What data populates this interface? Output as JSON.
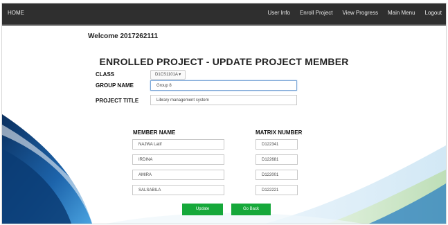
{
  "nav": {
    "home": "HOME",
    "links": [
      "User Info",
      "Enroll Project",
      "View Progress",
      "Main Menu",
      "Logout"
    ]
  },
  "welcome": "Welcome 2017262111",
  "page_title": "ENROLLED PROJECT - UPDATE PROJECT MEMBER",
  "form": {
    "class_label": "CLASS",
    "class_value": "D1CS1101A ▾",
    "group_label": "GROUP NAME",
    "group_value": "Group 8",
    "title_label": "PROJECT TITLE",
    "title_value": "Library management system"
  },
  "members": {
    "name_header": "MEMBER NAME",
    "matrix_header": "MATRIX NUMBER",
    "rows": [
      {
        "name": "NAJWA Latif",
        "matrix": "D122341"
      },
      {
        "name": "IRDINA",
        "matrix": "D122681"
      },
      {
        "name": "AMIRA",
        "matrix": "D122001"
      },
      {
        "name": "SALSABILA",
        "matrix": "D122221"
      }
    ]
  },
  "buttons": {
    "update": "Update",
    "back": "Go Back"
  },
  "colors": {
    "nav": "#2f2f2f",
    "button": "#16a83a",
    "wave_dark": "#0c3a6e",
    "wave_light": "#3b8fd0"
  }
}
